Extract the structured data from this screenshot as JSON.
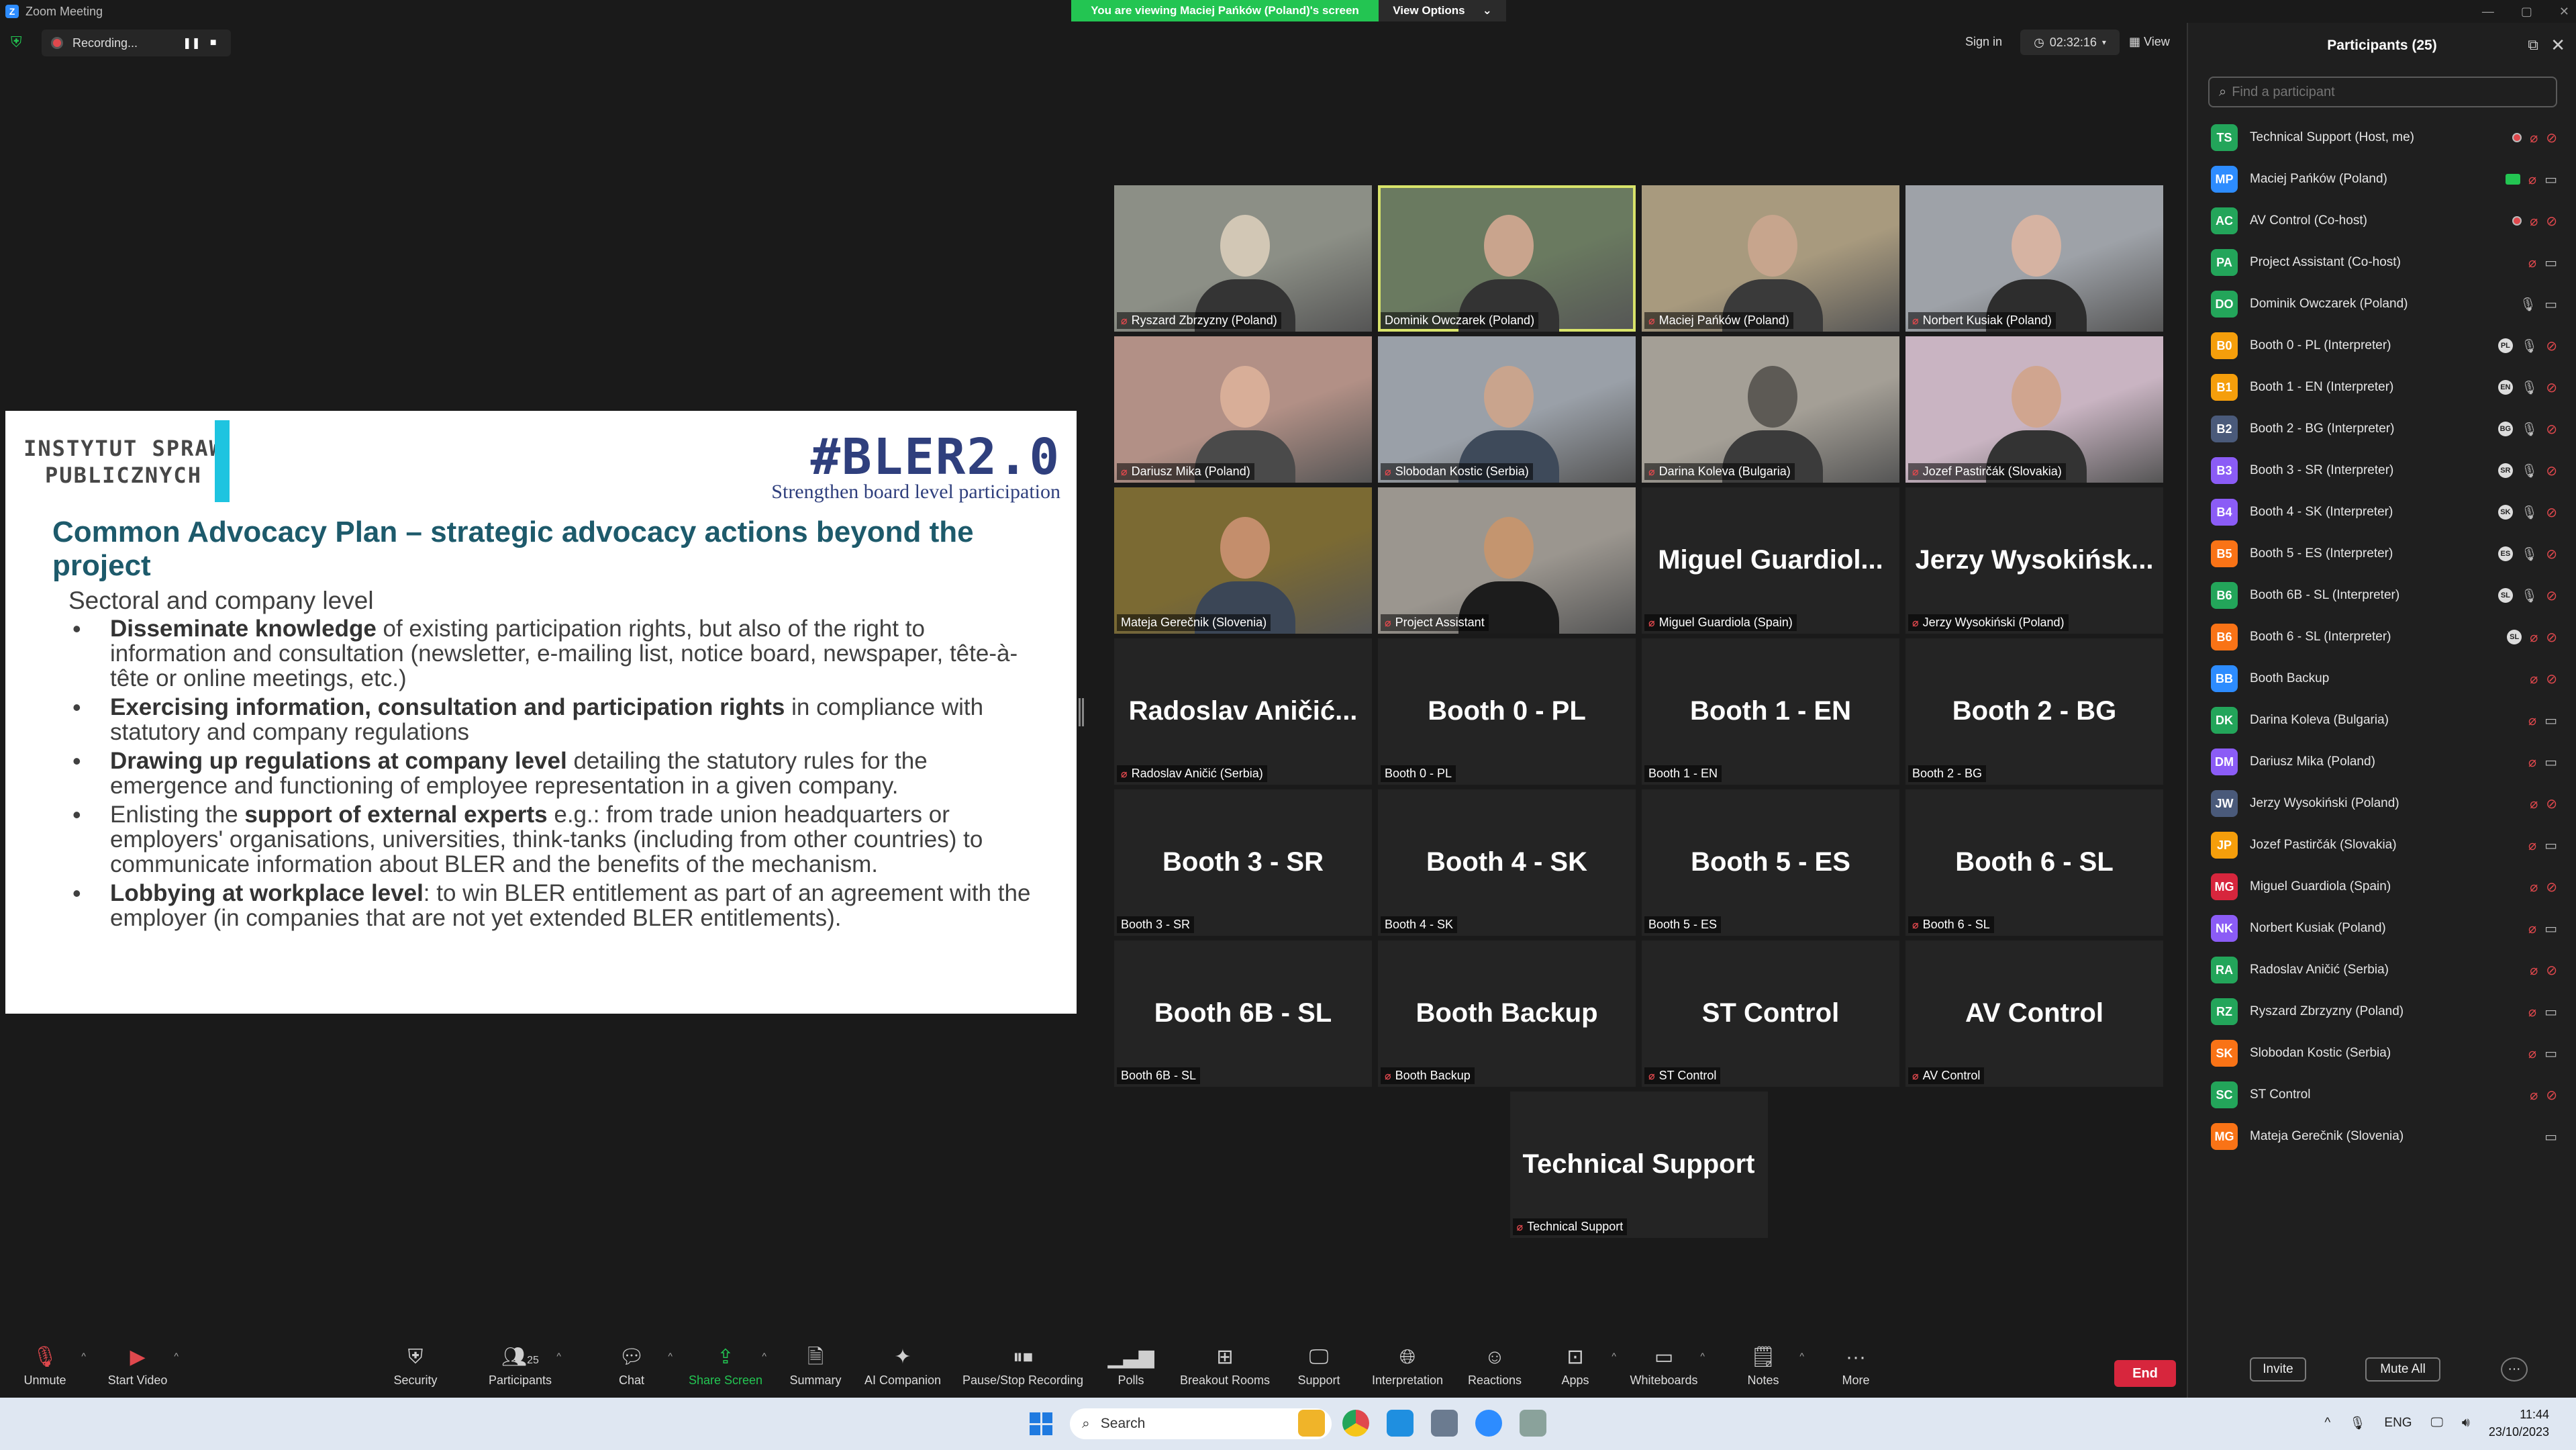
{
  "window": {
    "title": "Zoom Meeting",
    "controls": [
      "—",
      "▢",
      "✕"
    ]
  },
  "banner": {
    "viewing": "You are viewing Maciej Pańków (Poland)'s screen",
    "view_options": "View Options"
  },
  "status": {
    "recording": "Recording...",
    "sign_in": "Sign in",
    "timer": "02:32:16",
    "view": "View"
  },
  "slide": {
    "isp_logo_line1": "INSTYTUT SPRAW",
    "isp_logo_line2": "PUBLICZNYCH",
    "bler_title": "#BLER2.0",
    "bler_sub": "Strengthen board level participation",
    "heading": "Common Advocacy Plan – strategic advocacy actions beyond the project",
    "section": "Sectoral and company level",
    "bullets": [
      {
        "bold": "Disseminate knowledge",
        "text": " of existing participation rights, but also of the right to information and consultation (newsletter, e-mailing list, notice board, newspaper, tête-à-tête or online meetings, etc.)"
      },
      {
        "bold": "Exercising information, consultation and participation rights",
        "text": " in compliance with statutory and company regulations"
      },
      {
        "bold": "Drawing up regulations at company level",
        "text": " detailing the statutory rules for the emergence and functioning of employee representation in a given company."
      },
      {
        "pre": "Enlisting the ",
        "bold": "support of external experts",
        "text": " e.g.: from trade union headquarters or employers' organisations, universities, think-tanks (including from other countries) to communicate information about BLER and the benefits of the mechanism."
      },
      {
        "bold": "Lobbying at workplace level",
        "text": ": to win BLER entitlement as part of an agreement with the employer (in companies that are not yet extended BLER entitlements)."
      }
    ]
  },
  "gallery": {
    "tiles": [
      {
        "label": "Ryszard Zbrzyzny (Poland)",
        "big": "",
        "muted": true
      },
      {
        "label": "Dominik Owczarek (Poland)",
        "big": "",
        "muted": false
      },
      {
        "label": "Maciej Pańków (Poland)",
        "big": "",
        "muted": true
      },
      {
        "label": "Norbert Kusiak (Poland)",
        "big": "",
        "muted": true
      },
      {
        "label": "Dariusz Mika (Poland)",
        "big": "",
        "muted": true
      },
      {
        "label": "Slobodan Kostic (Serbia)",
        "big": "",
        "muted": true
      },
      {
        "label": "Darina Koleva (Bulgaria)",
        "big": "",
        "muted": true
      },
      {
        "label": "Jozef Pastirčák (Slovakia)",
        "big": "",
        "muted": true
      },
      {
        "label": "Mateja Gerečnik (Slovenia)",
        "big": "",
        "muted": false
      },
      {
        "label": "Project Assistant",
        "big": "",
        "muted": true
      },
      {
        "label": "Miguel Guardiola (Spain)",
        "big": "Miguel  Guardiol...",
        "muted": true
      },
      {
        "label": "Jerzy Wysokiński (Poland)",
        "big": "Jerzy  Wysokińsk...",
        "muted": true
      },
      {
        "label": "Radoslav Aničić (Serbia)",
        "big": "Radoslav  Aničić...",
        "muted": true
      },
      {
        "label": "Booth 0 - PL",
        "big": "Booth 0 - PL",
        "muted": false
      },
      {
        "label": "Booth 1 - EN",
        "big": "Booth 1 - EN",
        "muted": false
      },
      {
        "label": "Booth 2 - BG",
        "big": "Booth 2 - BG",
        "muted": false
      },
      {
        "label": "Booth 3 - SR",
        "big": "Booth 3 - SR",
        "muted": false
      },
      {
        "label": "Booth 4 - SK",
        "big": "Booth 4 - SK",
        "muted": false
      },
      {
        "label": "Booth 5 - ES",
        "big": "Booth 5 - ES",
        "muted": false
      },
      {
        "label": "Booth 6 - SL",
        "big": "Booth 6 - SL",
        "muted": true
      },
      {
        "label": "Booth 6B - SL",
        "big": "Booth 6B - SL",
        "muted": false
      },
      {
        "label": "Booth Backup",
        "big": "Booth Backup",
        "muted": true
      },
      {
        "label": "ST Control",
        "big": "ST Control",
        "muted": true
      },
      {
        "label": "AV Control",
        "big": "AV Control",
        "muted": true
      },
      {
        "label": "Technical Support",
        "big": "Technical Support",
        "muted": true
      }
    ]
  },
  "participants": {
    "title": "Participants (25)",
    "search_placeholder": "Find a participant",
    "list": [
      {
        "initials": "TS",
        "name": "Technical Support (Host, me)",
        "color": "#23a55a",
        "icons": [
          "rec",
          "mic-off",
          "cam-off"
        ]
      },
      {
        "initials": "MP",
        "name": "Maciej Pańków (Poland)",
        "color": "#2d8cff",
        "icons": [
          "share",
          "mic-off",
          "cam-on"
        ]
      },
      {
        "initials": "AC",
        "name": "AV Control (Co-host)",
        "color": "#23a55a",
        "icons": [
          "rec",
          "mic-off",
          "cam-off"
        ]
      },
      {
        "initials": "PA",
        "name": "Project Assistant (Co-host)",
        "color": "#23a55a",
        "icons": [
          "mic-off",
          "cam-on"
        ]
      },
      {
        "initials": "DO",
        "name": "Dominik Owczarek (Poland)",
        "color": "#23a55a",
        "icons": [
          "mic-on",
          "cam-on"
        ]
      },
      {
        "initials": "B0",
        "name": "Booth 0 - PL (Interpreter)",
        "color": "#f59e0b",
        "icons": [
          "lang:PL",
          "mic-on",
          "cam-off"
        ]
      },
      {
        "initials": "B1",
        "name": "Booth 1 - EN (Interpreter)",
        "color": "#f59e0b",
        "icons": [
          "lang:EN",
          "mic-on",
          "cam-off"
        ]
      },
      {
        "initials": "B2",
        "name": "Booth 2 - BG (Interpreter)",
        "color": "#4a5a7a",
        "icons": [
          "lang:BG",
          "mic-on",
          "cam-off"
        ]
      },
      {
        "initials": "B3",
        "name": "Booth 3 - SR (Interpreter)",
        "color": "#8b5cf6",
        "icons": [
          "lang:SR",
          "mic-on",
          "cam-off"
        ]
      },
      {
        "initials": "B4",
        "name": "Booth 4 - SK (Interpreter)",
        "color": "#8b5cf6",
        "icons": [
          "lang:SK",
          "mic-on",
          "cam-off"
        ]
      },
      {
        "initials": "B5",
        "name": "Booth 5 - ES (Interpreter)",
        "color": "#f97316",
        "icons": [
          "lang:ES",
          "mic-on",
          "cam-off"
        ]
      },
      {
        "initials": "B6",
        "name": "Booth 6B - SL (Interpreter)",
        "color": "#23a55a",
        "icons": [
          "lang:SL",
          "mic-on",
          "cam-off"
        ]
      },
      {
        "initials": "B6",
        "name": "Booth 6 - SL (Interpreter)",
        "color": "#f97316",
        "icons": [
          "lang:SL",
          "mic-off",
          "cam-off"
        ]
      },
      {
        "initials": "BB",
        "name": "Booth Backup",
        "color": "#2d8cff",
        "icons": [
          "mic-off",
          "cam-off"
        ]
      },
      {
        "initials": "DK",
        "name": "Darina Koleva (Bulgaria)",
        "color": "#23a55a",
        "icons": [
          "mic-off",
          "cam-on"
        ]
      },
      {
        "initials": "DM",
        "name": "Dariusz Mika (Poland)",
        "color": "#8b5cf6",
        "icons": [
          "mic-off",
          "cam-on"
        ]
      },
      {
        "initials": "JW",
        "name": "Jerzy Wysokiński (Poland)",
        "color": "#4a5a7a",
        "icons": [
          "mic-off",
          "cam-off"
        ]
      },
      {
        "initials": "JP",
        "name": "Jozef Pastirčák (Slovakia)",
        "color": "#f59e0b",
        "icons": [
          "mic-off",
          "cam-on"
        ]
      },
      {
        "initials": "MG",
        "name": "Miguel Guardiola (Spain)",
        "color": "#d7263d",
        "icons": [
          "mic-off",
          "cam-off"
        ]
      },
      {
        "initials": "NK",
        "name": "Norbert Kusiak (Poland)",
        "color": "#8b5cf6",
        "icons": [
          "mic-off",
          "cam-on"
        ]
      },
      {
        "initials": "RA",
        "name": "Radoslav Aničić (Serbia)",
        "color": "#23a55a",
        "icons": [
          "mic-off",
          "cam-off"
        ]
      },
      {
        "initials": "RZ",
        "name": "Ryszard Zbrzyzny (Poland)",
        "color": "#23a55a",
        "icons": [
          "mic-off",
          "cam-on"
        ]
      },
      {
        "initials": "SK",
        "name": "Slobodan Kostic (Serbia)",
        "color": "#f97316",
        "icons": [
          "mic-off",
          "cam-on"
        ]
      },
      {
        "initials": "SC",
        "name": "ST Control",
        "color": "#23a55a",
        "icons": [
          "mic-off",
          "cam-off"
        ]
      },
      {
        "initials": "MG",
        "name": "Mateja Gerečnik (Slovenia)",
        "color": "#f97316",
        "icons": [
          "cam-on"
        ]
      }
    ],
    "invite": "Invite",
    "mute_all": "Mute All",
    "more": "···"
  },
  "toolbar": {
    "unmute": "Unmute",
    "start_video": "Start Video",
    "security": "Security",
    "participants": "Participants",
    "participants_count": "25",
    "chat": "Chat",
    "share_screen": "Share Screen",
    "summary": "Summary",
    "ai_companion": "AI Companion",
    "pause_stop_recording": "Pause/Stop Recording",
    "polls": "Polls",
    "breakout_rooms": "Breakout Rooms",
    "support": "Support",
    "interpretation": "Interpretation",
    "reactions": "Reactions",
    "apps": "Apps",
    "whiteboards": "Whiteboards",
    "notes": "Notes",
    "more": "More",
    "end": "End"
  },
  "taskbar": {
    "search": "Search",
    "lang": "ENG",
    "time": "11:44",
    "date": "23/10/2023"
  }
}
